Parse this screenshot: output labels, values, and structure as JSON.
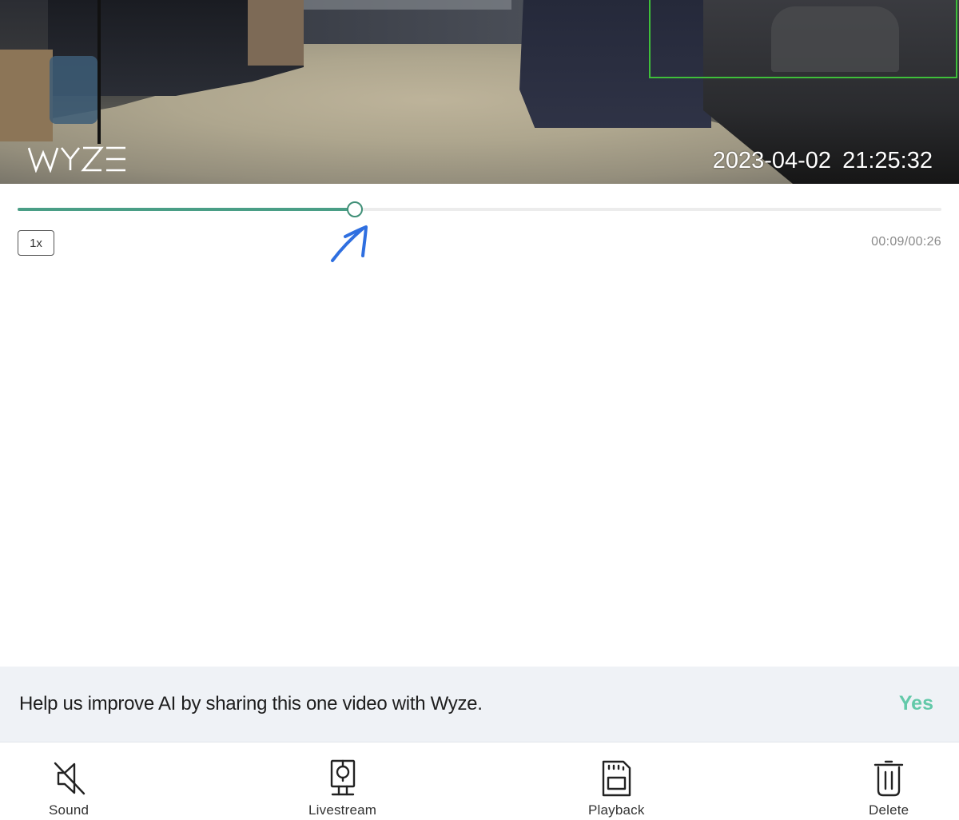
{
  "video": {
    "brand_watermark": "WYZE",
    "timestamp": "2023-04-02  21:25:32",
    "detection_box_color": "#3fbf3a"
  },
  "playback": {
    "progress_fraction": 0.3654,
    "speed_label": "1x",
    "time_readout": "00:09/00:26",
    "accent_color": "#4a9e86"
  },
  "ai_banner": {
    "message": "Help us improve AI by sharing this one video with Wyze.",
    "yes_label": "Yes",
    "yes_color": "#63c9a9"
  },
  "toolbar": {
    "items": [
      {
        "label": "Sound",
        "icon": "sound-muted-icon"
      },
      {
        "label": "Livestream",
        "icon": "camera-icon"
      },
      {
        "label": "Playback",
        "icon": "sd-card-icon"
      },
      {
        "label": "Delete",
        "icon": "trash-icon"
      }
    ]
  }
}
